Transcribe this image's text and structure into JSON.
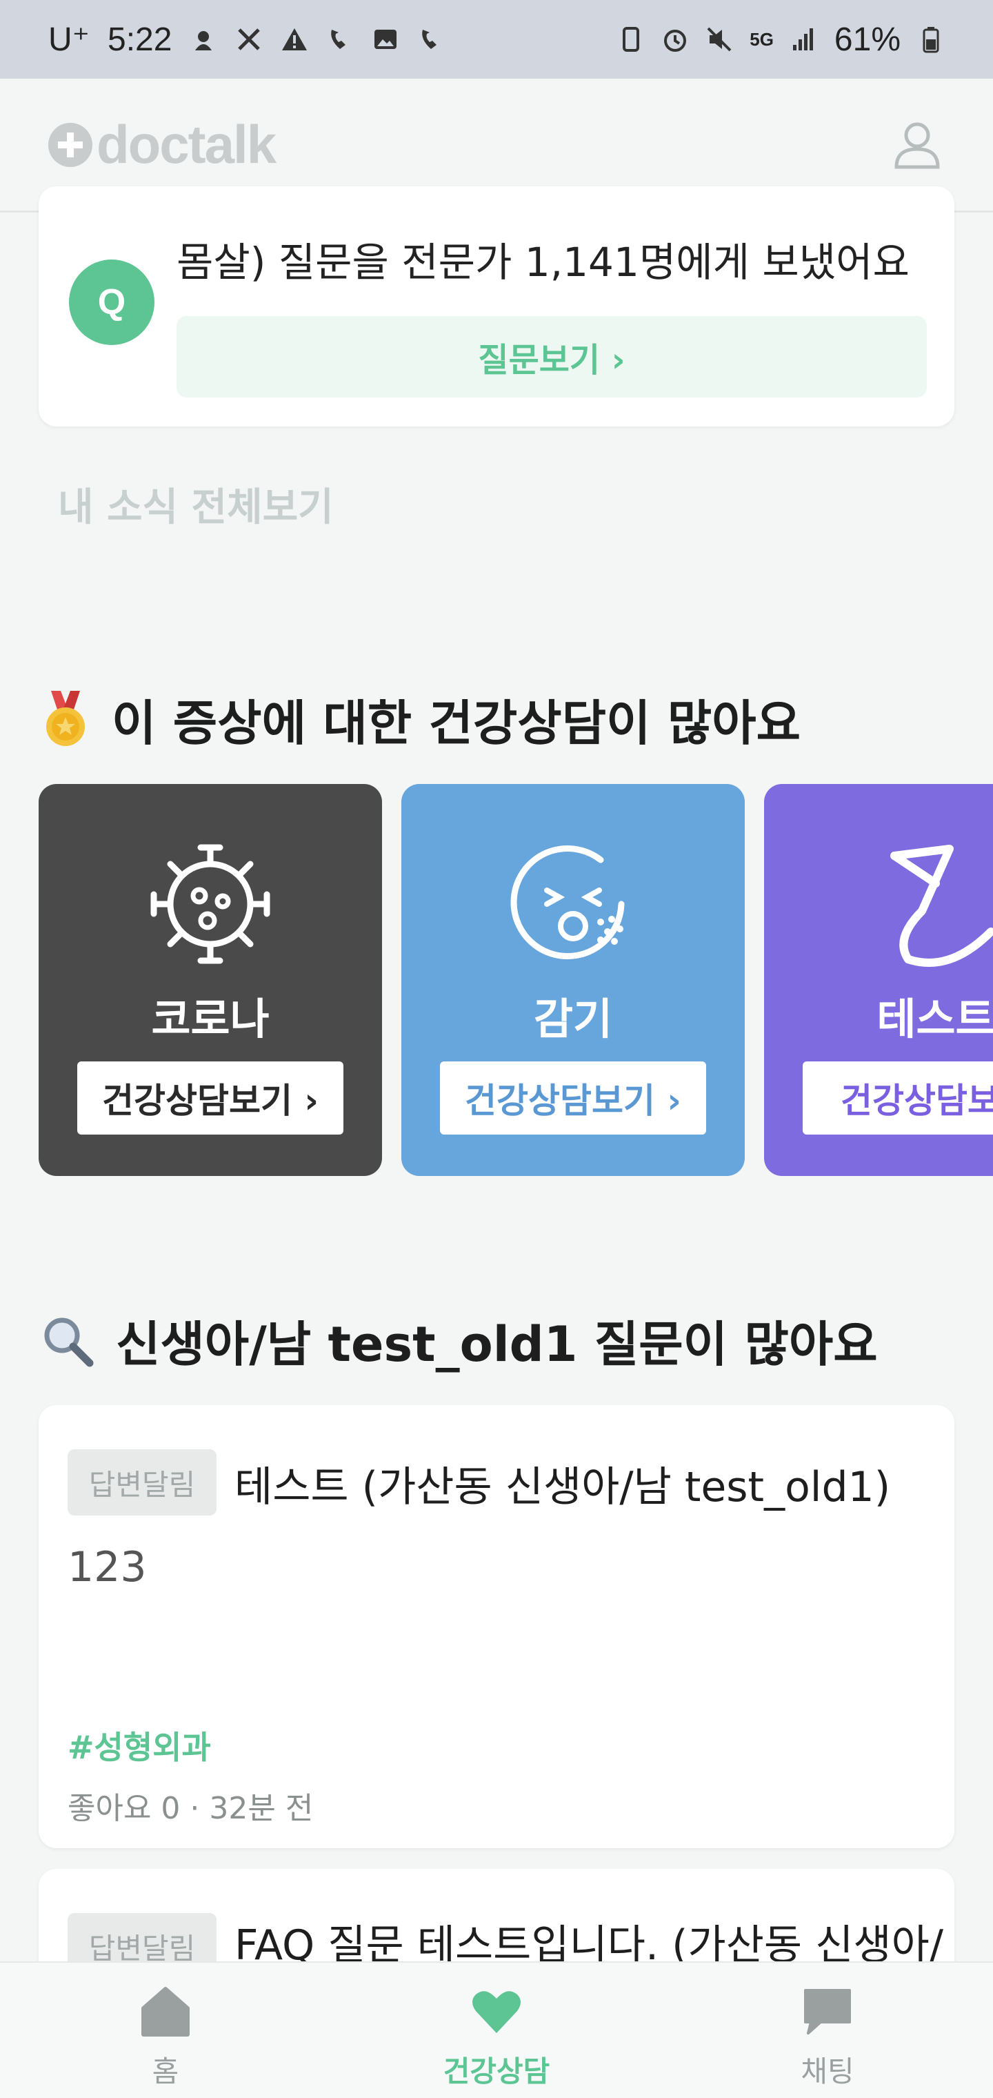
{
  "status_bar": {
    "carrier": "U⁺",
    "time": "5:22",
    "battery": "61%",
    "network": "5G"
  },
  "header": {
    "logo_text": "doctalk",
    "profile_icon": "user-icon"
  },
  "question_card": {
    "avatar_letter": "Q",
    "text_line1": "몸살) 질문을 전문가 1,141명에게 보냈어요",
    "view_button": "질문보기 ›"
  },
  "news_all_link": "내 소식 전체보기",
  "symptom_section": {
    "title": "이 증상에 대한 건강상담이 많아요",
    "cards": [
      {
        "name": "코로나",
        "button": "건강상담보기 ›",
        "bg": "#4a4a4a",
        "btn_color": "#2a2a2a",
        "icon": "virus-icon"
      },
      {
        "name": "감기",
        "button": "건강상담보기 ›",
        "bg": "#67a5dd",
        "btn_color": "#5a98d4",
        "icon": "sneeze-icon"
      },
      {
        "name": "테스트",
        "button": "건강상담보기",
        "bg": "#7e6be0",
        "btn_color": "#7a5fe0",
        "icon": "test-icon"
      }
    ]
  },
  "questions_section": {
    "title": "신생아/남 test_old1 질문이 많아요",
    "posts": [
      {
        "badge": "답변달림",
        "title": "테스트 (가산동 신생아/남 test_old1)",
        "body": "123",
        "tag": "#성형외과",
        "meta": "좋아요 0 · 32분 전"
      },
      {
        "badge": "답변달림",
        "title": "FAQ 질문 테스트입니다. (가산동 신생아/"
      }
    ]
  },
  "bottom_nav": {
    "items": [
      {
        "label": "홈",
        "icon": "home-icon"
      },
      {
        "label": "건강상담",
        "icon": "heart-icon"
      },
      {
        "label": "채팅",
        "icon": "chat-icon"
      }
    ]
  },
  "colors": {
    "brand_green": "#5cc593",
    "background": "#f4f6f6"
  }
}
